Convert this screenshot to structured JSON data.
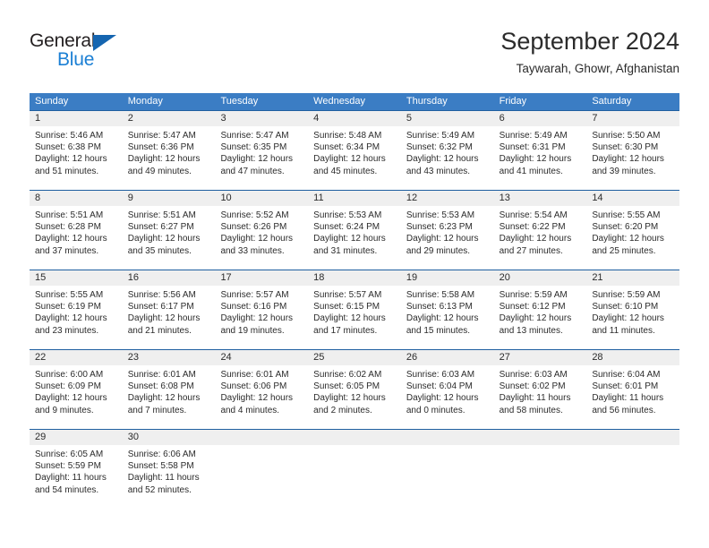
{
  "brand": {
    "name_top": "General",
    "name_bottom": "Blue",
    "triangle_icon": "triangle-icon",
    "color_dark": "#231f20",
    "color_blue": "#1b7fd4"
  },
  "header": {
    "title": "September 2024",
    "subtitle": "Taywarah, Ghowr, Afghanistan"
  },
  "theme": {
    "header_bg": "#3b7dc4",
    "row_border": "#1f5fa0",
    "day_band_bg": "#efefef",
    "text": "#2b2b2b"
  },
  "weekdays": [
    "Sunday",
    "Monday",
    "Tuesday",
    "Wednesday",
    "Thursday",
    "Friday",
    "Saturday"
  ],
  "weeks": [
    [
      {
        "day": "1",
        "sunrise": "Sunrise: 5:46 AM",
        "sunset": "Sunset: 6:38 PM",
        "daylight1": "Daylight: 12 hours",
        "daylight2": "and 51 minutes."
      },
      {
        "day": "2",
        "sunrise": "Sunrise: 5:47 AM",
        "sunset": "Sunset: 6:36 PM",
        "daylight1": "Daylight: 12 hours",
        "daylight2": "and 49 minutes."
      },
      {
        "day": "3",
        "sunrise": "Sunrise: 5:47 AM",
        "sunset": "Sunset: 6:35 PM",
        "daylight1": "Daylight: 12 hours",
        "daylight2": "and 47 minutes."
      },
      {
        "day": "4",
        "sunrise": "Sunrise: 5:48 AM",
        "sunset": "Sunset: 6:34 PM",
        "daylight1": "Daylight: 12 hours",
        "daylight2": "and 45 minutes."
      },
      {
        "day": "5",
        "sunrise": "Sunrise: 5:49 AM",
        "sunset": "Sunset: 6:32 PM",
        "daylight1": "Daylight: 12 hours",
        "daylight2": "and 43 minutes."
      },
      {
        "day": "6",
        "sunrise": "Sunrise: 5:49 AM",
        "sunset": "Sunset: 6:31 PM",
        "daylight1": "Daylight: 12 hours",
        "daylight2": "and 41 minutes."
      },
      {
        "day": "7",
        "sunrise": "Sunrise: 5:50 AM",
        "sunset": "Sunset: 6:30 PM",
        "daylight1": "Daylight: 12 hours",
        "daylight2": "and 39 minutes."
      }
    ],
    [
      {
        "day": "8",
        "sunrise": "Sunrise: 5:51 AM",
        "sunset": "Sunset: 6:28 PM",
        "daylight1": "Daylight: 12 hours",
        "daylight2": "and 37 minutes."
      },
      {
        "day": "9",
        "sunrise": "Sunrise: 5:51 AM",
        "sunset": "Sunset: 6:27 PM",
        "daylight1": "Daylight: 12 hours",
        "daylight2": "and 35 minutes."
      },
      {
        "day": "10",
        "sunrise": "Sunrise: 5:52 AM",
        "sunset": "Sunset: 6:26 PM",
        "daylight1": "Daylight: 12 hours",
        "daylight2": "and 33 minutes."
      },
      {
        "day": "11",
        "sunrise": "Sunrise: 5:53 AM",
        "sunset": "Sunset: 6:24 PM",
        "daylight1": "Daylight: 12 hours",
        "daylight2": "and 31 minutes."
      },
      {
        "day": "12",
        "sunrise": "Sunrise: 5:53 AM",
        "sunset": "Sunset: 6:23 PM",
        "daylight1": "Daylight: 12 hours",
        "daylight2": "and 29 minutes."
      },
      {
        "day": "13",
        "sunrise": "Sunrise: 5:54 AM",
        "sunset": "Sunset: 6:22 PM",
        "daylight1": "Daylight: 12 hours",
        "daylight2": "and 27 minutes."
      },
      {
        "day": "14",
        "sunrise": "Sunrise: 5:55 AM",
        "sunset": "Sunset: 6:20 PM",
        "daylight1": "Daylight: 12 hours",
        "daylight2": "and 25 minutes."
      }
    ],
    [
      {
        "day": "15",
        "sunrise": "Sunrise: 5:55 AM",
        "sunset": "Sunset: 6:19 PM",
        "daylight1": "Daylight: 12 hours",
        "daylight2": "and 23 minutes."
      },
      {
        "day": "16",
        "sunrise": "Sunrise: 5:56 AM",
        "sunset": "Sunset: 6:17 PM",
        "daylight1": "Daylight: 12 hours",
        "daylight2": "and 21 minutes."
      },
      {
        "day": "17",
        "sunrise": "Sunrise: 5:57 AM",
        "sunset": "Sunset: 6:16 PM",
        "daylight1": "Daylight: 12 hours",
        "daylight2": "and 19 minutes."
      },
      {
        "day": "18",
        "sunrise": "Sunrise: 5:57 AM",
        "sunset": "Sunset: 6:15 PM",
        "daylight1": "Daylight: 12 hours",
        "daylight2": "and 17 minutes."
      },
      {
        "day": "19",
        "sunrise": "Sunrise: 5:58 AM",
        "sunset": "Sunset: 6:13 PM",
        "daylight1": "Daylight: 12 hours",
        "daylight2": "and 15 minutes."
      },
      {
        "day": "20",
        "sunrise": "Sunrise: 5:59 AM",
        "sunset": "Sunset: 6:12 PM",
        "daylight1": "Daylight: 12 hours",
        "daylight2": "and 13 minutes."
      },
      {
        "day": "21",
        "sunrise": "Sunrise: 5:59 AM",
        "sunset": "Sunset: 6:10 PM",
        "daylight1": "Daylight: 12 hours",
        "daylight2": "and 11 minutes."
      }
    ],
    [
      {
        "day": "22",
        "sunrise": "Sunrise: 6:00 AM",
        "sunset": "Sunset: 6:09 PM",
        "daylight1": "Daylight: 12 hours",
        "daylight2": "and 9 minutes."
      },
      {
        "day": "23",
        "sunrise": "Sunrise: 6:01 AM",
        "sunset": "Sunset: 6:08 PM",
        "daylight1": "Daylight: 12 hours",
        "daylight2": "and 7 minutes."
      },
      {
        "day": "24",
        "sunrise": "Sunrise: 6:01 AM",
        "sunset": "Sunset: 6:06 PM",
        "daylight1": "Daylight: 12 hours",
        "daylight2": "and 4 minutes."
      },
      {
        "day": "25",
        "sunrise": "Sunrise: 6:02 AM",
        "sunset": "Sunset: 6:05 PM",
        "daylight1": "Daylight: 12 hours",
        "daylight2": "and 2 minutes."
      },
      {
        "day": "26",
        "sunrise": "Sunrise: 6:03 AM",
        "sunset": "Sunset: 6:04 PM",
        "daylight1": "Daylight: 12 hours",
        "daylight2": "and 0 minutes."
      },
      {
        "day": "27",
        "sunrise": "Sunrise: 6:03 AM",
        "sunset": "Sunset: 6:02 PM",
        "daylight1": "Daylight: 11 hours",
        "daylight2": "and 58 minutes."
      },
      {
        "day": "28",
        "sunrise": "Sunrise: 6:04 AM",
        "sunset": "Sunset: 6:01 PM",
        "daylight1": "Daylight: 11 hours",
        "daylight2": "and 56 minutes."
      }
    ],
    [
      {
        "day": "29",
        "sunrise": "Sunrise: 6:05 AM",
        "sunset": "Sunset: 5:59 PM",
        "daylight1": "Daylight: 11 hours",
        "daylight2": "and 54 minutes."
      },
      {
        "day": "30",
        "sunrise": "Sunrise: 6:06 AM",
        "sunset": "Sunset: 5:58 PM",
        "daylight1": "Daylight: 11 hours",
        "daylight2": "and 52 minutes."
      },
      {
        "day": "",
        "sunrise": "",
        "sunset": "",
        "daylight1": "",
        "daylight2": ""
      },
      {
        "day": "",
        "sunrise": "",
        "sunset": "",
        "daylight1": "",
        "daylight2": ""
      },
      {
        "day": "",
        "sunrise": "",
        "sunset": "",
        "daylight1": "",
        "daylight2": ""
      },
      {
        "day": "",
        "sunrise": "",
        "sunset": "",
        "daylight1": "",
        "daylight2": ""
      },
      {
        "day": "",
        "sunrise": "",
        "sunset": "",
        "daylight1": "",
        "daylight2": ""
      }
    ]
  ]
}
